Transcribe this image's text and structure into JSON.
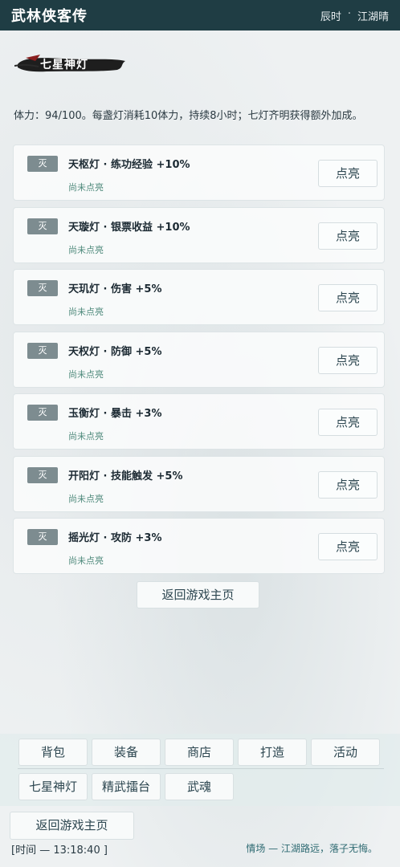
{
  "header": {
    "title": "武林侠客传",
    "time_of_day": "辰时",
    "separator": "·",
    "weather": "江湖晴"
  },
  "section": {
    "title": "七星神灯"
  },
  "info_text": "体力：94/100。每盏灯消耗10体力，持续8小时；七灯齐明获得额外加成。",
  "lamps": [
    {
      "tag": "灭",
      "name": "天枢灯 · 练功经验 +10%",
      "state": "尚未点亮",
      "button": "点亮"
    },
    {
      "tag": "灭",
      "name": "天璇灯 · 银票收益 +10%",
      "state": "尚未点亮",
      "button": "点亮"
    },
    {
      "tag": "灭",
      "name": "天玑灯 · 伤害 +5%",
      "state": "尚未点亮",
      "button": "点亮"
    },
    {
      "tag": "灭",
      "name": "天权灯 · 防御 +5%",
      "state": "尚未点亮",
      "button": "点亮"
    },
    {
      "tag": "灭",
      "name": "玉衡灯 · 暴击 +3%",
      "state": "尚未点亮",
      "button": "点亮"
    },
    {
      "tag": "灭",
      "name": "开阳灯 · 技能触发 +5%",
      "state": "尚未点亮",
      "button": "点亮"
    },
    {
      "tag": "灭",
      "name": "摇光灯 · 攻防 +3%",
      "state": "尚未点亮",
      "button": "点亮"
    }
  ],
  "return_button": "返回游戏主页",
  "nav": {
    "row1": [
      "背包",
      "装备",
      "商店",
      "打造",
      "活动"
    ],
    "row2": [
      "七星神灯",
      "精武擂台",
      "武魂"
    ]
  },
  "footer": {
    "return_button": "返回游戏主页",
    "clock": "[时间 — 13:18:40 ]",
    "motto": "情场 — 江湖路远，落子无悔。"
  },
  "colors": {
    "header_bg": "#1f3d44",
    "tag_bg": "#7d8c90",
    "state_text": "#4f8a7c"
  }
}
